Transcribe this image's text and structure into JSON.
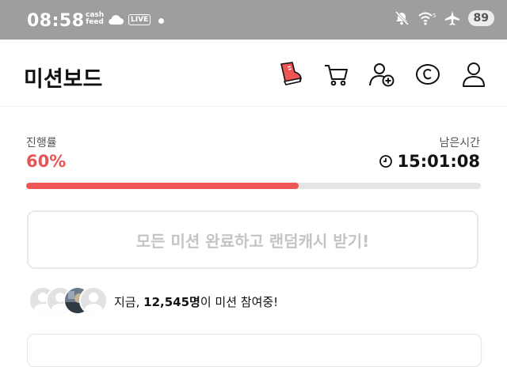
{
  "status_bar": {
    "time": "08:58",
    "cashfeed_top": "cash",
    "cashfeed_bottom": "feed",
    "live_badge": "LIVE",
    "battery": "89"
  },
  "header": {
    "title": "미션보드"
  },
  "progress": {
    "label": "진행률",
    "value": "60%",
    "fraction": 0.6,
    "remaining_label": "남은시간",
    "remaining_time": "15:01:08"
  },
  "reward_button": {
    "label": "모든 미션 완료하고 랜덤캐시 받기!"
  },
  "participants": {
    "prefix": "지금, ",
    "count": "12,545명",
    "suffix": "이 미션 참여중!"
  },
  "colors": {
    "accent": "#ee5555",
    "status_bar": "#9e9e9e"
  }
}
